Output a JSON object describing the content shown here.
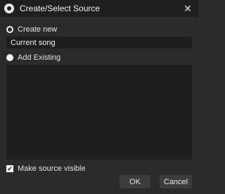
{
  "window": {
    "title": "Create/Select Source",
    "app_icon": "obs-logo-icon",
    "close_glyph": "✕"
  },
  "create_new": {
    "label": "Create new",
    "selected": true
  },
  "source_name": {
    "value": "Current song"
  },
  "add_existing": {
    "label": "Add Existing",
    "selected": false,
    "items": []
  },
  "visible_option": {
    "label": "Make source visible",
    "checked": true,
    "check_glyph": "✔"
  },
  "buttons": {
    "ok": "OK",
    "cancel": "Cancel"
  },
  "colors": {
    "background": "#2b2b2b",
    "titlebar": "#1f1f1f",
    "field": "#1e1e1e",
    "button": "#3c3c3c"
  }
}
